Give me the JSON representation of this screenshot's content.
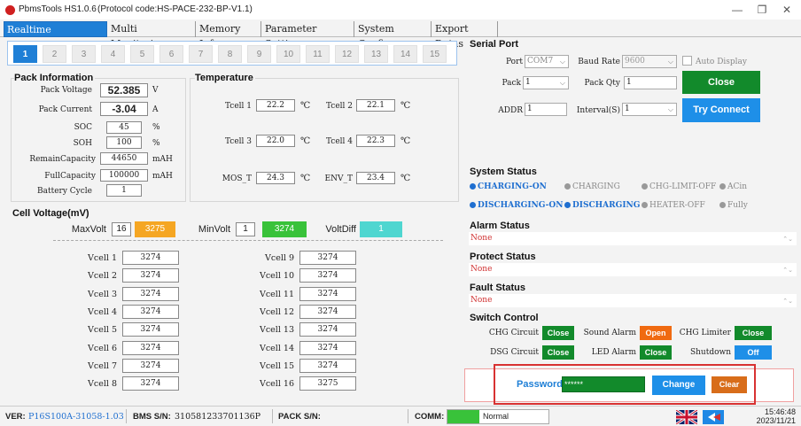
{
  "window": {
    "title": "PbmsTools HS1.0.6",
    "protocol": "(Protocol code:HS-PACE-232-BP-V1.1)",
    "controls": [
      "—",
      "❐",
      "✕"
    ]
  },
  "tabs": [
    "Realtime Monitoring",
    "Multi Monitoring",
    "Memory Info.",
    "Parameter Setting",
    "System Config.",
    "Export Datas"
  ],
  "packs": [
    "1",
    "2",
    "3",
    "4",
    "5",
    "6",
    "7",
    "8",
    "9",
    "10",
    "11",
    "12",
    "13",
    "14",
    "15"
  ],
  "pack_info": {
    "title": "Pack Information",
    "rows": [
      {
        "label": "Pack Voltage",
        "value": "52.385",
        "unit": "V"
      },
      {
        "label": "Pack Current",
        "value": "-3.04",
        "unit": "A"
      },
      {
        "label": "SOC",
        "value": "45",
        "unit": "%"
      },
      {
        "label": "SOH",
        "value": "100",
        "unit": "%"
      },
      {
        "label": "RemainCapacity",
        "value": "44650",
        "unit": "mAH"
      },
      {
        "label": "FullCapacity",
        "value": "100000",
        "unit": "mAH"
      },
      {
        "label": "Battery Cycle",
        "value": "1",
        "unit": ""
      }
    ]
  },
  "temperature": {
    "title": "Temperature",
    "unit": "℃",
    "items": [
      {
        "label": "Tcell 1",
        "value": "22.2"
      },
      {
        "label": "Tcell 2",
        "value": "22.1"
      },
      {
        "label": "Tcell 3",
        "value": "22.0"
      },
      {
        "label": "Tcell 4",
        "value": "22.3"
      },
      {
        "label": "MOS_T",
        "value": "24.3"
      },
      {
        "label": "ENV_T",
        "value": "23.4"
      }
    ]
  },
  "cell_voltage": {
    "title": "Cell Voltage(mV)",
    "max_label": "MaxVolt",
    "max_idx": "16",
    "max_val": "3275",
    "min_label": "MinVolt",
    "min_idx": "1",
    "min_val": "3274",
    "diff_label": "VoltDiff",
    "diff_val": "1",
    "left": [
      {
        "label": "Vcell 1",
        "value": "3274"
      },
      {
        "label": "Vcell 2",
        "value": "3274"
      },
      {
        "label": "Vcell 3",
        "value": "3274"
      },
      {
        "label": "Vcell 4",
        "value": "3274"
      },
      {
        "label": "Vcell 5",
        "value": "3274"
      },
      {
        "label": "Vcell 6",
        "value": "3274"
      },
      {
        "label": "Vcell 7",
        "value": "3274"
      },
      {
        "label": "Vcell 8",
        "value": "3274"
      }
    ],
    "right": [
      {
        "label": "Vcell 9",
        "value": "3274"
      },
      {
        "label": "Vcell 10",
        "value": "3274"
      },
      {
        "label": "Vcell 11",
        "value": "3274"
      },
      {
        "label": "Vcell 12",
        "value": "3274"
      },
      {
        "label": "Vcell 13",
        "value": "3274"
      },
      {
        "label": "Vcell 14",
        "value": "3274"
      },
      {
        "label": "Vcell 15",
        "value": "3274"
      },
      {
        "label": "Vcell 16",
        "value": "3275"
      }
    ]
  },
  "serial": {
    "title": "Serial Port",
    "port_label": "Port",
    "port_value": "COM7",
    "baud_label": "Baud Rate",
    "baud_value": "9600",
    "auto_display": "Auto Display",
    "pack_label": "Pack",
    "pack_value": "1",
    "qty_label": "Pack Qty",
    "qty_value": "1",
    "close": "Close",
    "addr_label": "ADDR",
    "addr_value": "1",
    "interval_label": "Interval(S)",
    "interval_value": "1",
    "try_connect": "Try Connect"
  },
  "system_status": {
    "title": "System Status",
    "items": [
      {
        "label": "CHARGING-ON",
        "on": true
      },
      {
        "label": "CHARGING",
        "on": false
      },
      {
        "label": "CHG-LIMIT-OFF",
        "on": false
      },
      {
        "label": "ACin",
        "on": false
      },
      {
        "label": "DISCHARGING-ON",
        "on": true
      },
      {
        "label": "DISCHARGING",
        "on": true
      },
      {
        "label": "HEATER-OFF",
        "on": false
      },
      {
        "label": "Fully",
        "on": false
      }
    ]
  },
  "alarm": {
    "title": "Alarm Status",
    "value": "None"
  },
  "protect": {
    "title": "Protect Status",
    "value": "None"
  },
  "fault": {
    "title": "Fault Status",
    "value": "None"
  },
  "switch_control": {
    "title": "Switch Control",
    "items": [
      {
        "label": "CHG Circuit",
        "button": "Close",
        "color": "#128a2b"
      },
      {
        "label": "Sound Alarm",
        "button": "Open",
        "color": "#f06a10"
      },
      {
        "label": "CHG Limiter",
        "button": "Close",
        "color": "#128a2b"
      },
      {
        "label": "DSG Circuit",
        "button": "Close",
        "color": "#128a2b"
      },
      {
        "label": "LED Alarm",
        "button": "Close",
        "color": "#128a2b"
      },
      {
        "label": "Shutdown",
        "button": "Off",
        "color": "#1e8fe8"
      }
    ]
  },
  "password": {
    "label": "Password",
    "value": "******",
    "change": "Change",
    "clear": "Clear"
  },
  "statusbar": {
    "ver_label": "VER:",
    "ver_value": "P16S100A-31058-1.03",
    "bms_label": "BMS S/N:",
    "bms_value": "310581233701136P",
    "pack_sn_label": "PACK S/N:",
    "comm_label": "COMM:",
    "comm_value": "Normal",
    "time": "15:46:48",
    "date": "2023/11/21"
  },
  "colors": {
    "accent": "#1f7fd6",
    "green": "#128a2b",
    "orange": "#f5a623",
    "cyan": "#4fd6d0",
    "bright_green": "#39c23a"
  }
}
